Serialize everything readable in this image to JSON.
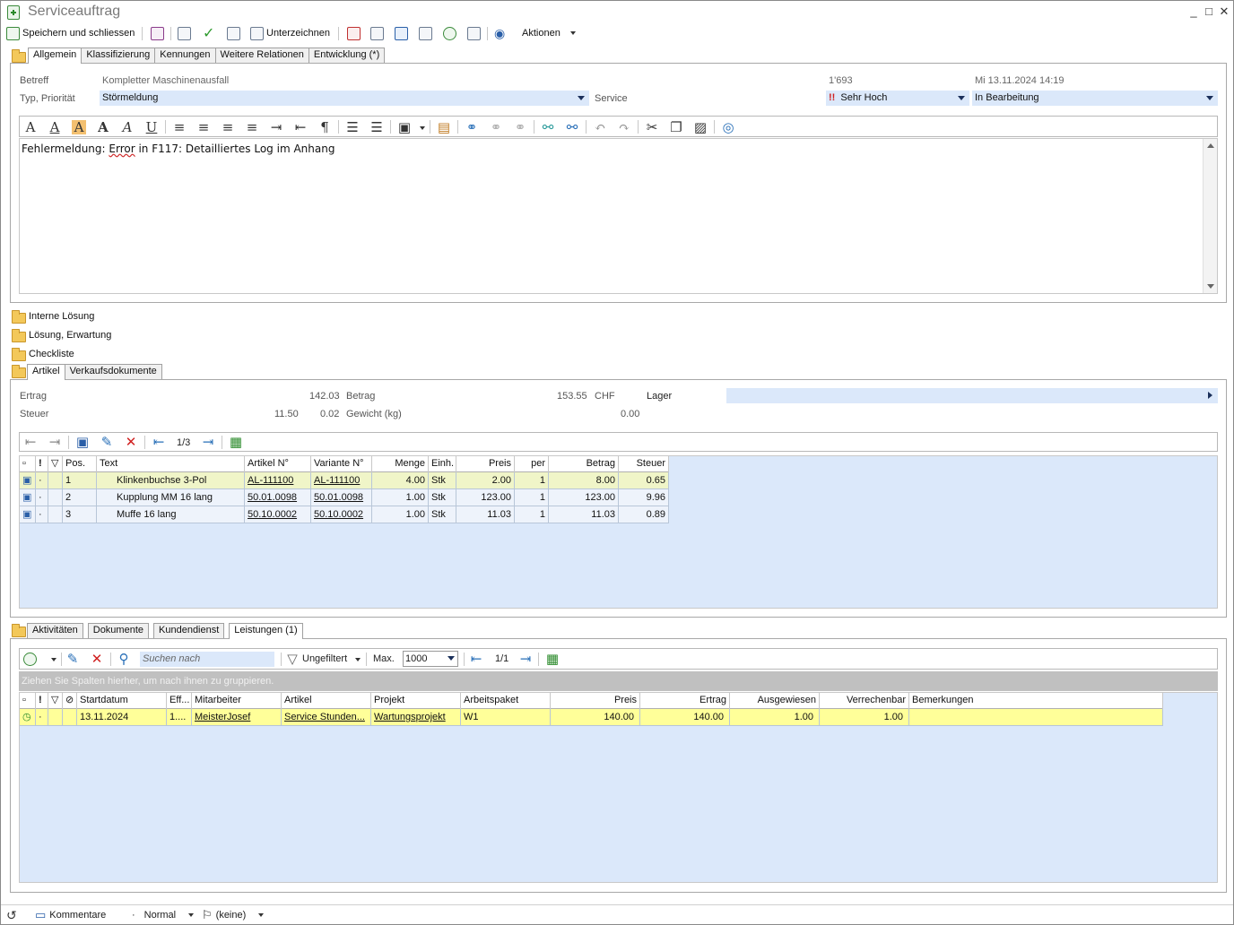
{
  "window": {
    "title": "Serviceauftrag",
    "controls": [
      "_",
      "□",
      "✕"
    ]
  },
  "toolbar": {
    "save_close": "Speichern und schliessen",
    "sign": "Unterzeichnen",
    "actions": "Aktionen"
  },
  "main_tabs": [
    "Allgemein",
    "Klassifizierung",
    "Kennungen",
    "Weitere Relationen",
    "Entwicklung (*)"
  ],
  "general": {
    "subject_label": "Betreff",
    "subject_value": "Kompletter Maschinenausfall",
    "number": "1'693",
    "date": "Mi 13.11.2024 14:19",
    "type_label": "Typ, Priorität",
    "type_value": "Störmeldung",
    "service_label": "Service",
    "priority_mark": "!!",
    "priority_value": "Sehr Hoch",
    "status_value": "In Bearbeitung"
  },
  "editor": {
    "text_before": "Fehlermeldung: ",
    "text_error": "Error",
    "text_after": " in F117: Detailliertes Log im Anhang"
  },
  "sections": [
    "Interne Lösung",
    "Lösung, Erwartung",
    "Checkliste"
  ],
  "article_tabs": [
    "Artikel",
    "Verkaufsdokumente"
  ],
  "articles_summary": {
    "ertrag_label": "Ertrag",
    "ertrag_value": "142.03",
    "betrag_label": "Betrag",
    "betrag_value": "153.55",
    "currency": "CHF",
    "lager_label": "Lager",
    "steuer_label": "Steuer",
    "steuer_value": "11.50",
    "steuer_value2": "0.02",
    "gewicht_label": "Gewicht (kg)",
    "gewicht_value": "0.00"
  },
  "articles_grid": {
    "pager": "1/3",
    "columns": [
      "Pos.",
      "Text",
      "Artikel N°",
      "Variante N°",
      "Menge",
      "Einh.",
      "Preis",
      "per",
      "Betrag",
      "Steuer"
    ],
    "rows": [
      {
        "pos": "1",
        "text": "Klinkenbuchse 3-Pol",
        "artikel": "AL-111100",
        "variante": "AL-111100",
        "menge": "4.00",
        "einh": "Stk",
        "preis": "2.00",
        "per": "1",
        "betrag": "8.00",
        "steuer": "0.65"
      },
      {
        "pos": "2",
        "text": "Kupplung MM 16 lang",
        "artikel": "50.01.0098",
        "variante": "50.01.0098",
        "menge": "1.00",
        "einh": "Stk",
        "preis": "123.00",
        "per": "1",
        "betrag": "123.00",
        "steuer": "9.96"
      },
      {
        "pos": "3",
        "text": "Muffe 16 lang",
        "artikel": "50.10.0002",
        "variante": "50.10.0002",
        "menge": "1.00",
        "einh": "Stk",
        "preis": "11.03",
        "per": "1",
        "betrag": "11.03",
        "steuer": "0.89"
      }
    ]
  },
  "bottom_tabs": [
    "Aktivitäten",
    "Dokumente",
    "Kundendienst",
    "Leistungen (1)"
  ],
  "services_grid": {
    "search_placeholder": "Suchen nach",
    "filter": "Ungefiltert",
    "max_label": "Max.",
    "max_value": "1000",
    "pager": "1/1",
    "group_hint": "Ziehen Sie Spalten hierher, um nach ihnen zu gruppieren.",
    "columns": [
      "Startdatum",
      "Eff...",
      "Mitarbeiter",
      "Artikel",
      "Projekt",
      "Arbeitspaket",
      "Preis",
      "Ertrag",
      "Ausgewiesen",
      "Verrechenbar",
      "Bemerkungen"
    ],
    "rows": [
      {
        "start": "13.11.2024",
        "eff": "1....",
        "mitarbeiter": "MeisterJosef",
        "artikel": "Service Stunden...",
        "projekt": "Wartungsprojekt",
        "paket": "W1",
        "preis": "140.00",
        "ertrag": "140.00",
        "ausgewiesen": "1.00",
        "verrechenbar": "1.00",
        "bemerkungen": ""
      }
    ]
  },
  "statusbar": {
    "comments": "Kommentare",
    "level": "Normal",
    "flag": "(keine)"
  }
}
